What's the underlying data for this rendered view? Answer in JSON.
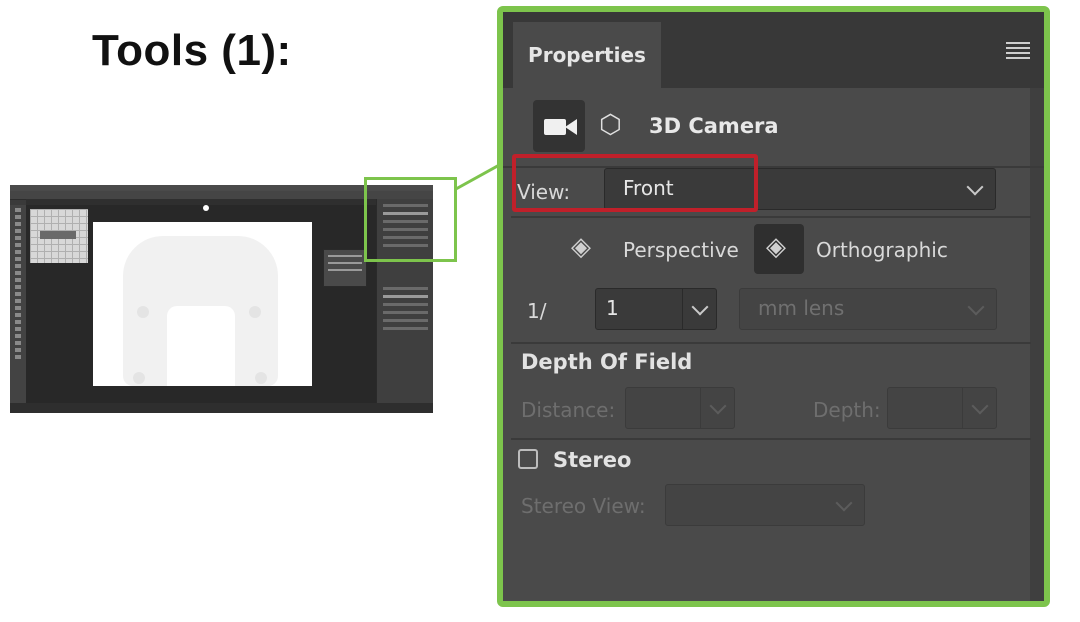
{
  "heading": "Tools (1):",
  "properties_panel": {
    "tab_label": "Properties",
    "section_label": "3D Camera",
    "view": {
      "label": "View:",
      "value": "Front"
    },
    "projection": {
      "perspective_label": "Perspective",
      "orthographic_label": "Orthographic",
      "selected": "Orthographic"
    },
    "lens": {
      "prefix": "1/",
      "value": "1",
      "unit_placeholder": "mm lens"
    },
    "depth_of_field": {
      "title": "Depth Of Field",
      "distance_label": "Distance:",
      "depth_label": "Depth:"
    },
    "stereo": {
      "label": "Stereo",
      "checked": false,
      "view_label": "Stereo View:"
    }
  },
  "colors": {
    "highlight_green": "#7dc44c",
    "highlight_red": "#c0202a",
    "panel_bg": "#4a4a4a"
  }
}
